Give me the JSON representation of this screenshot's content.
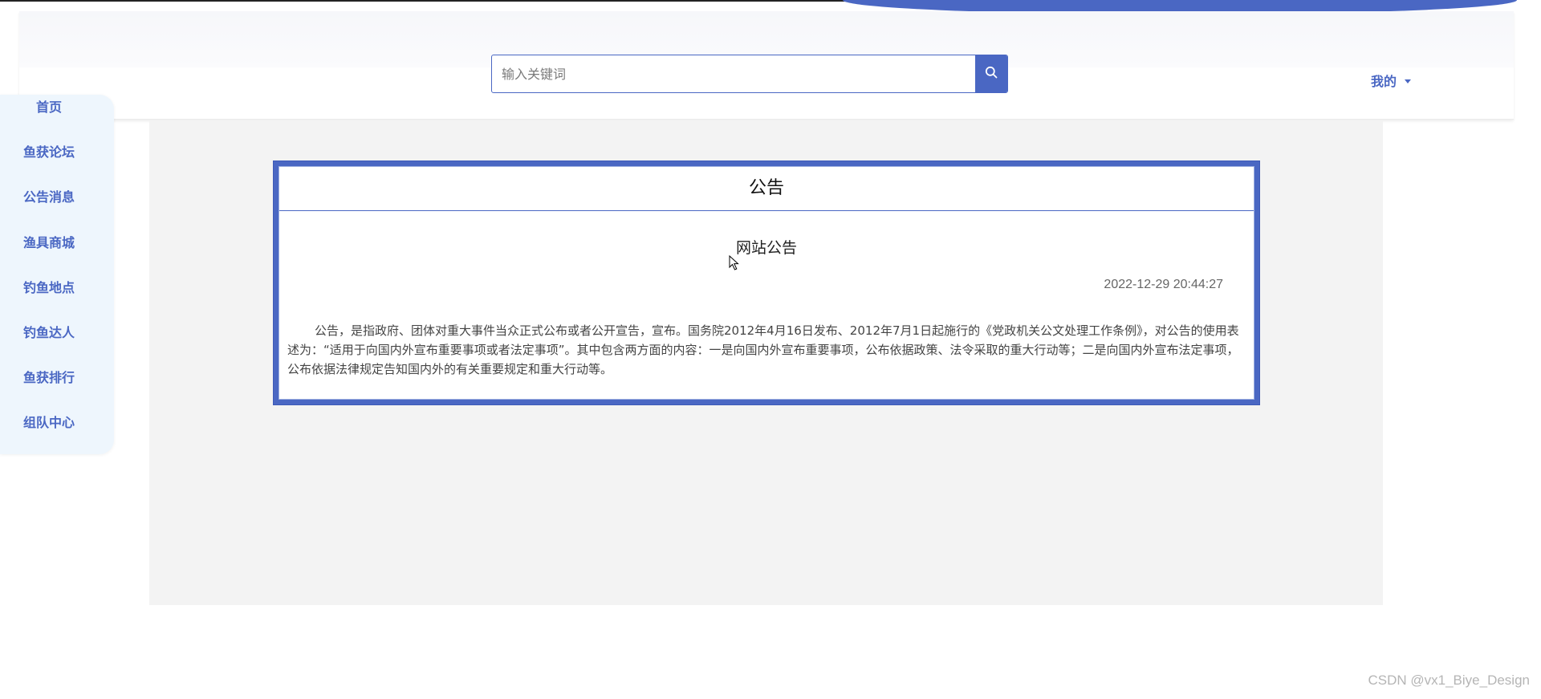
{
  "search": {
    "placeholder": "输入关键词",
    "icon": "search-icon"
  },
  "user_menu": {
    "label": "我的",
    "icon": "caret-down-icon"
  },
  "sidebar": {
    "items": [
      {
        "label": "首页"
      },
      {
        "label": "鱼获论坛"
      },
      {
        "label": "公告消息"
      },
      {
        "label": "渔具商城"
      },
      {
        "label": "钓鱼地点"
      },
      {
        "label": "钓鱼达人"
      },
      {
        "label": "鱼获排行"
      },
      {
        "label": "组队中心"
      }
    ]
  },
  "notice": {
    "header": "公告",
    "title": "网站公告",
    "time": "2022-12-29 20:44:27",
    "content": "公告，是指政府、团体对重大事件当众正式公布或者公开宣告，宣布。国务院2012年4月16日发布、2012年7月1日起施行的《党政机关公文处理工作条例》，对公告的使用表述为：“适用于向国内外宣布重要事项或者法定事项”。其中包含两方面的内容：一是向国内外宣布重要事项，公布依据政策、法令采取的重大行动等；二是向国内外宣布法定事项，公布依据法律规定告知国内外的有关重要规定和重大行动等。"
  },
  "watermark": "CSDN @vx1_Biye_Design",
  "colors": {
    "accent": "#4a67c3",
    "main_bg": "#f3f3f3",
    "sidebar_bg": "#eef6fd"
  }
}
